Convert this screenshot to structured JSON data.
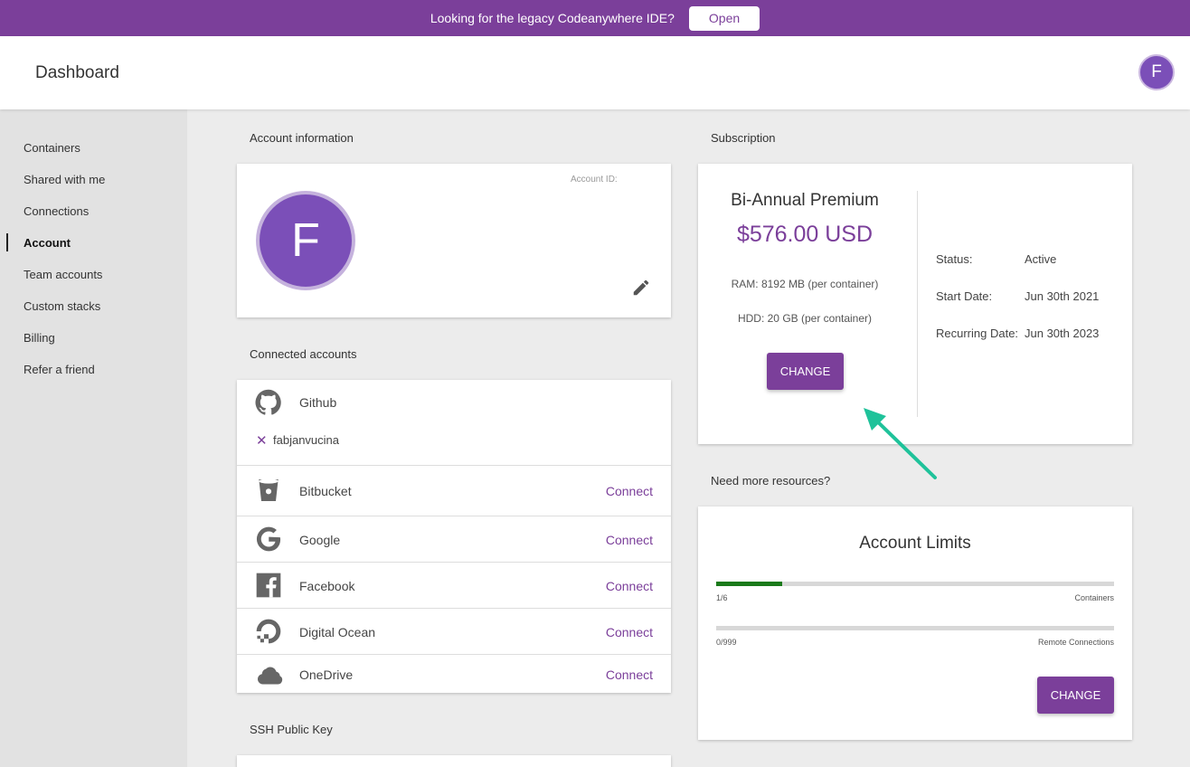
{
  "banner": {
    "text": "Looking for the legacy Codeanywhere IDE?",
    "button": "Open"
  },
  "header": {
    "title": "Dashboard",
    "avatar_initial": "F"
  },
  "sidebar": {
    "items": [
      {
        "label": "Containers"
      },
      {
        "label": "Shared with me"
      },
      {
        "label": "Connections"
      },
      {
        "label": "Account",
        "active": true
      },
      {
        "label": "Team accounts"
      },
      {
        "label": "Custom stacks"
      },
      {
        "label": "Billing"
      },
      {
        "label": "Refer a friend"
      }
    ]
  },
  "account_info": {
    "section_label": "Account information",
    "avatar_initial": "F",
    "account_id_label": "Account ID:"
  },
  "connected_accounts": {
    "section_label": "Connected accounts",
    "github": {
      "name": "Github",
      "username": "fabjanvucina",
      "remove_glyph": "✕"
    },
    "items": [
      {
        "name": "Bitbucket",
        "action": "Connect",
        "icon": "bitbucket-icon"
      },
      {
        "name": "Google",
        "action": "Connect",
        "icon": "google-icon"
      },
      {
        "name": "Facebook",
        "action": "Connect",
        "icon": "facebook-icon"
      },
      {
        "name": "Digital Ocean",
        "action": "Connect",
        "icon": "digitalocean-icon"
      },
      {
        "name": "OneDrive",
        "action": "Connect",
        "icon": "onedrive-icon"
      }
    ]
  },
  "ssh": {
    "section_label": "SSH Public Key"
  },
  "subscription": {
    "section_label": "Subscription",
    "plan": "Bi-Annual Premium",
    "price": "$576.00 USD",
    "ram": "RAM:  8192 MB  (per container)",
    "hdd": "HDD:  20 GB  (per container)",
    "button": "CHANGE",
    "status_label": "Status:",
    "status_value": "Active",
    "start_label": "Start Date:",
    "start_value": "Jun 30th 2021",
    "recurring_label": "Recurring Date:",
    "recurring_value": "Jun 30th 2023"
  },
  "resources": {
    "section_label": "Need more resources?",
    "title": "Account Limits",
    "containers": {
      "count": "1/6",
      "label": "Containers",
      "used": 1,
      "total": 6
    },
    "remote": {
      "count": "0/999",
      "label": "Remote Connections",
      "used": 0,
      "total": 999
    },
    "button": "CHANGE"
  },
  "colors": {
    "brand": "#7b3f9a",
    "progress": "#1a7a1a",
    "arrow": "#1fc29a"
  }
}
